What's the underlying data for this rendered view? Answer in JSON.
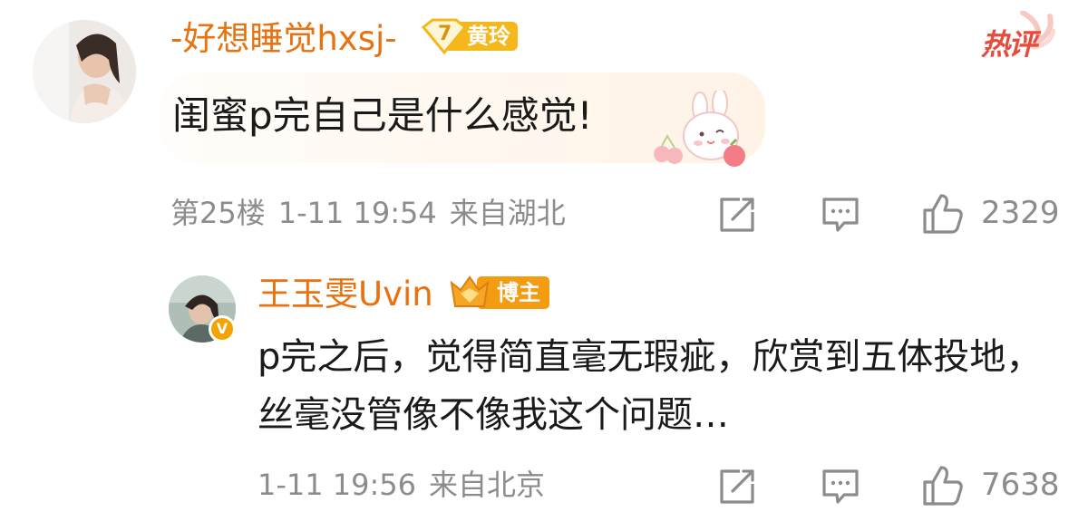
{
  "comment": {
    "username": "-好想睡觉hxsj-",
    "fan_badge_level": "7",
    "fan_badge_label": "黄玲",
    "hot_badge": "热评",
    "text": "闺蜜p完自己是什么感觉!",
    "floor": "第25楼",
    "time": "1-11 19:54",
    "location": "来自湖北",
    "like_count": "2329"
  },
  "reply": {
    "username": "王玉雯Uvin",
    "badge_label": "博主",
    "verified_mark": "V",
    "text": "p完之后，觉得简直毫无瑕疵，欣赏到五体投地，丝毫没管像不像我这个问题…",
    "time": "1-11 19:56",
    "location": "来自北京",
    "like_count": "7638"
  },
  "colors": {
    "username": "#e8720f",
    "meta_text": "#8c8c8c",
    "hot_badge": "#e64b3c",
    "fan_badge": "#f5b81c",
    "blogger_badge": "#f39c12",
    "verified": "#f5a300"
  },
  "icons": {
    "share": "share-icon",
    "comment": "comment-icon",
    "like": "like-icon"
  }
}
